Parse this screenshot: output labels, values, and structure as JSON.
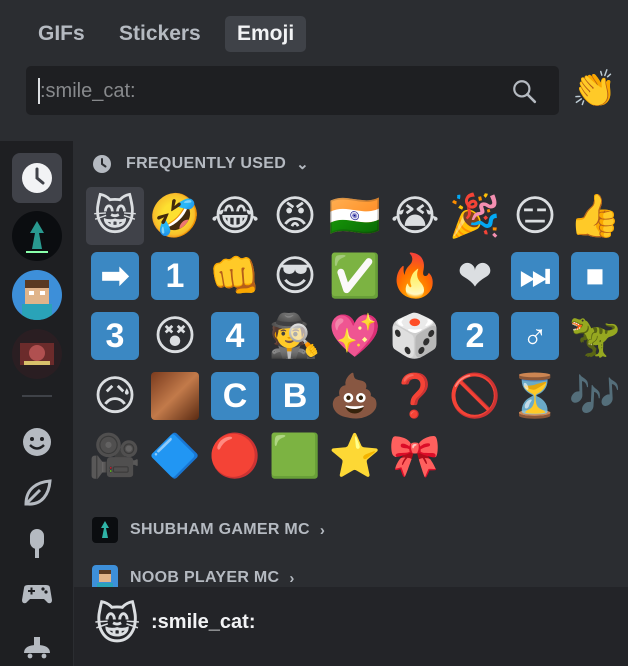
{
  "tabs": [
    {
      "label": "GIFs",
      "active": false
    },
    {
      "label": "Stickers",
      "active": false
    },
    {
      "label": "Emoji",
      "active": true
    }
  ],
  "search": {
    "placeholder": ":smile_cat:",
    "value": ""
  },
  "skin_tone_emoji": "👏",
  "sidebar": {
    "items": [
      "recent-icon",
      "shubham-gamer-mc-server-icon",
      "noob-player-mc-server-icon",
      "third-server-icon",
      "smiley-category-icon",
      "leaf-category-icon",
      "popsicle-category-icon",
      "gamepad-category-icon",
      "travel-category-icon"
    ]
  },
  "sections": {
    "frequently_used": "FREQUENTLY USED",
    "guild1": "SHUBHAM GAMER MC",
    "guild2": "NOOB PLAYER MC"
  },
  "emojis": [
    [
      "😸",
      "🤣",
      "😂",
      "😡",
      "🇮🇳",
      "😭",
      "🎉",
      "😑",
      "👍"
    ],
    [
      "➡",
      "1",
      "👊",
      "😎",
      "✅",
      "🔥",
      "❤",
      "⏭",
      "⏹"
    ],
    [
      "3",
      "😵",
      "4",
      "🕵",
      "💖",
      "🎲",
      "2",
      "♂",
      "🦖"
    ],
    [
      "😥",
      "[img]",
      "C",
      "B",
      "💩",
      "❓",
      "🚫",
      "⏳",
      "🎶"
    ],
    [
      "🎥",
      "🔷",
      "🔴",
      "🟩",
      "⭐",
      "🎀"
    ]
  ],
  "footer": {
    "emoji": "😸",
    "name": ":smile_cat:"
  },
  "colors": {
    "background": "#2b2d31",
    "sidebar": "#1e1f22",
    "footer": "#232428",
    "keycap": "#3b88c3",
    "active_tab": "#3f4248"
  }
}
